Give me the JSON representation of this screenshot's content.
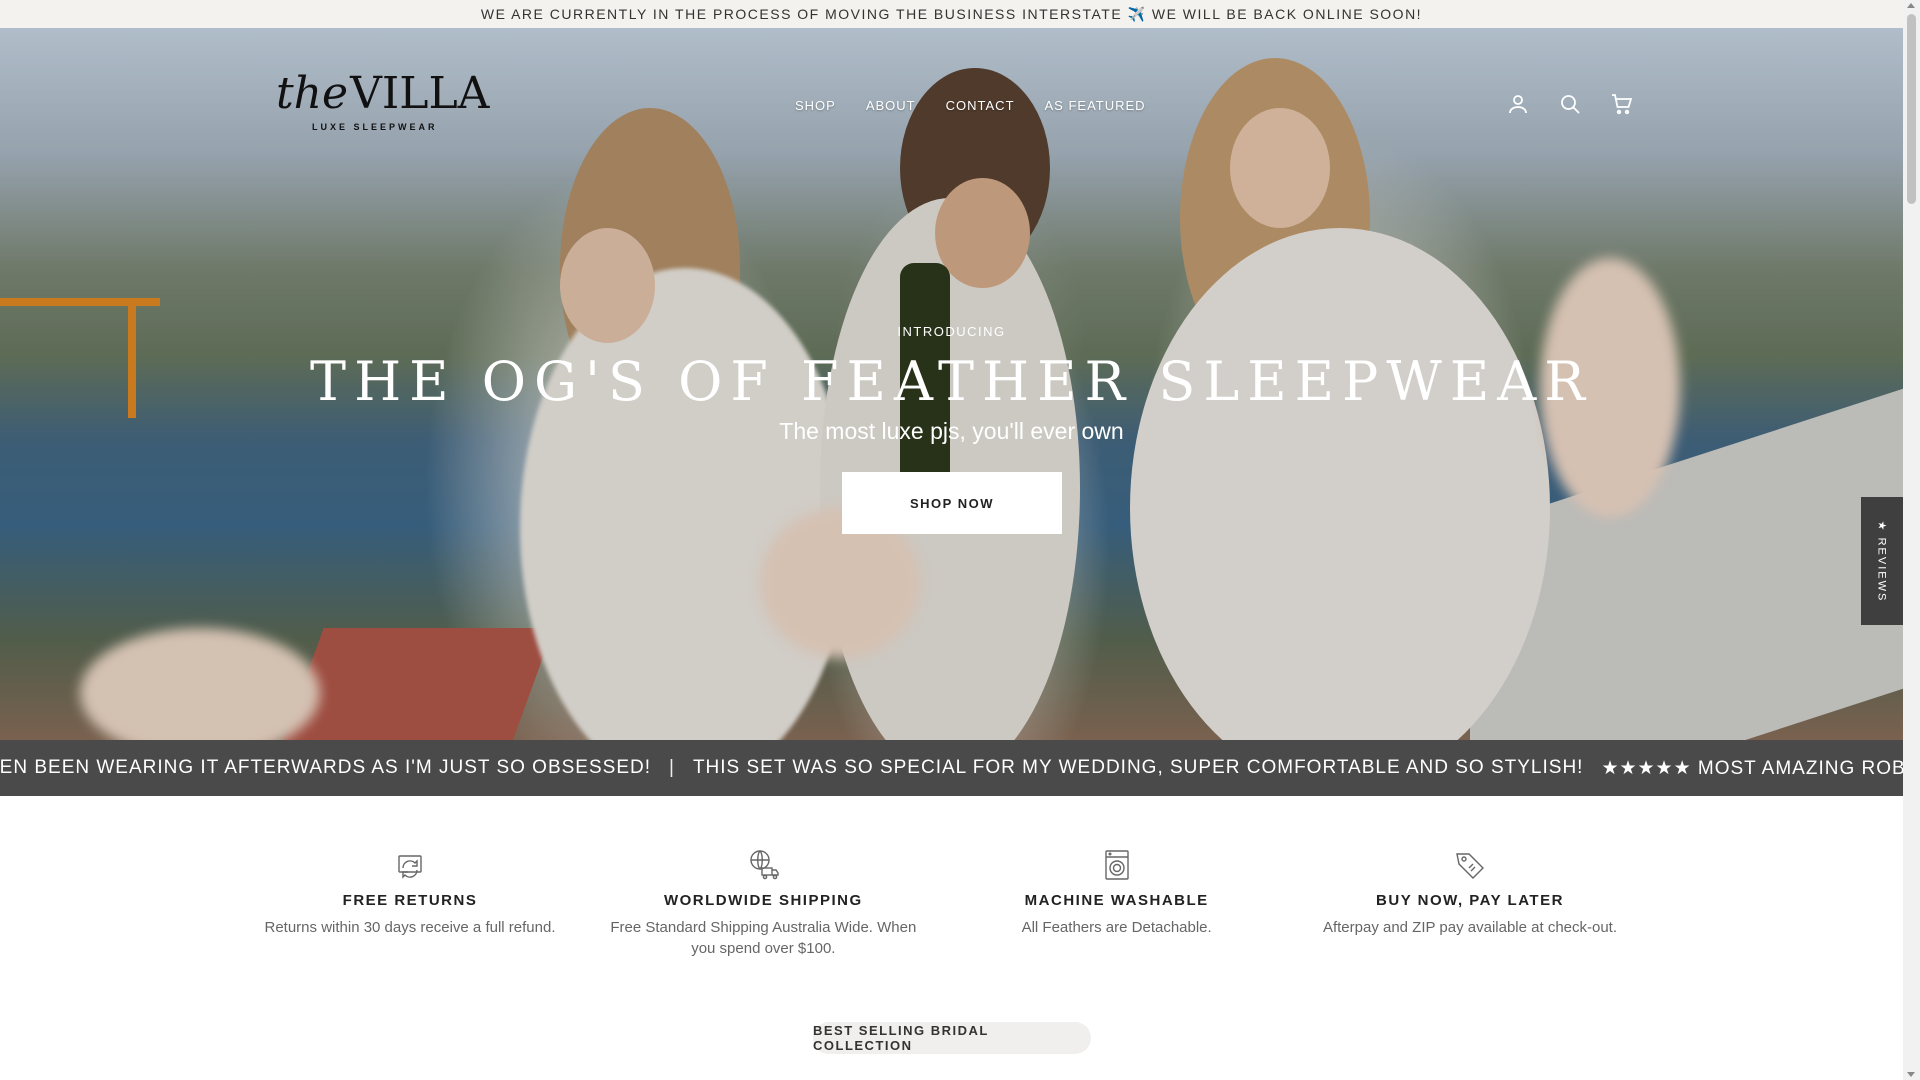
{
  "announcement": {
    "text": "WE ARE CURRENTLY IN THE PROCESS OF MOVING THE BUSINESS INTERSTATE ✈️ WE WILL BE BACK ONLINE SOON!"
  },
  "logo": {
    "script": "the",
    "main": "VILLA",
    "tagline": "LUXE SLEEPWEAR"
  },
  "nav": {
    "items": [
      "SHOP",
      "ABOUT",
      "CONTACT",
      "AS FEATURED"
    ]
  },
  "header_icons": [
    "account-icon",
    "search-icon",
    "cart-icon"
  ],
  "hero": {
    "intro": "INTRODUCING",
    "headline": "THE OG'S OF FEATHER SLEEPWEAR",
    "subhead": "The most luxe pjs, you'll ever own",
    "cta": "SHOP NOW"
  },
  "reviews_tab": {
    "label": "★ REVIEWS"
  },
  "ticker": {
    "items": [
      "VEN BEEN WEARING IT AFTERWARDS AS I'M JUST SO OBSESSED!",
      "|",
      "THIS SET WAS SO SPECIAL FOR MY WEDDING, SUPER COMFORTABLE AND SO STYLISH!",
      "★★★★★ MOST AMAZING ROBE I HAVE EVE"
    ]
  },
  "features": [
    {
      "icon": "returns-icon",
      "title": "FREE RETURNS",
      "desc": "Returns within 30 days receive a full refund."
    },
    {
      "icon": "shipping-truck-icon",
      "title": "WORLDWIDE SHIPPING",
      "desc": "Free Standard Shipping Australia Wide. When you spend over $100."
    },
    {
      "icon": "washing-machine-icon",
      "title": "MACHINE WASHABLE",
      "desc": "All Feathers are Detachable."
    },
    {
      "icon": "price-tag-icon",
      "title": "BUY NOW, PAY LATER",
      "desc": "Afterpay and ZIP pay available at check-out."
    }
  ],
  "collection_pill": {
    "label": "BEST SELLING BRIDAL COLLECTION"
  },
  "colors": {
    "announcement_bg": "#f4f2ee",
    "ticker_bg": "#4a4a4a",
    "reviews_tab_bg": "#3f3f3f",
    "pill_bg": "#f0efed",
    "text_dark": "#222222",
    "text_muted": "#666666"
  }
}
